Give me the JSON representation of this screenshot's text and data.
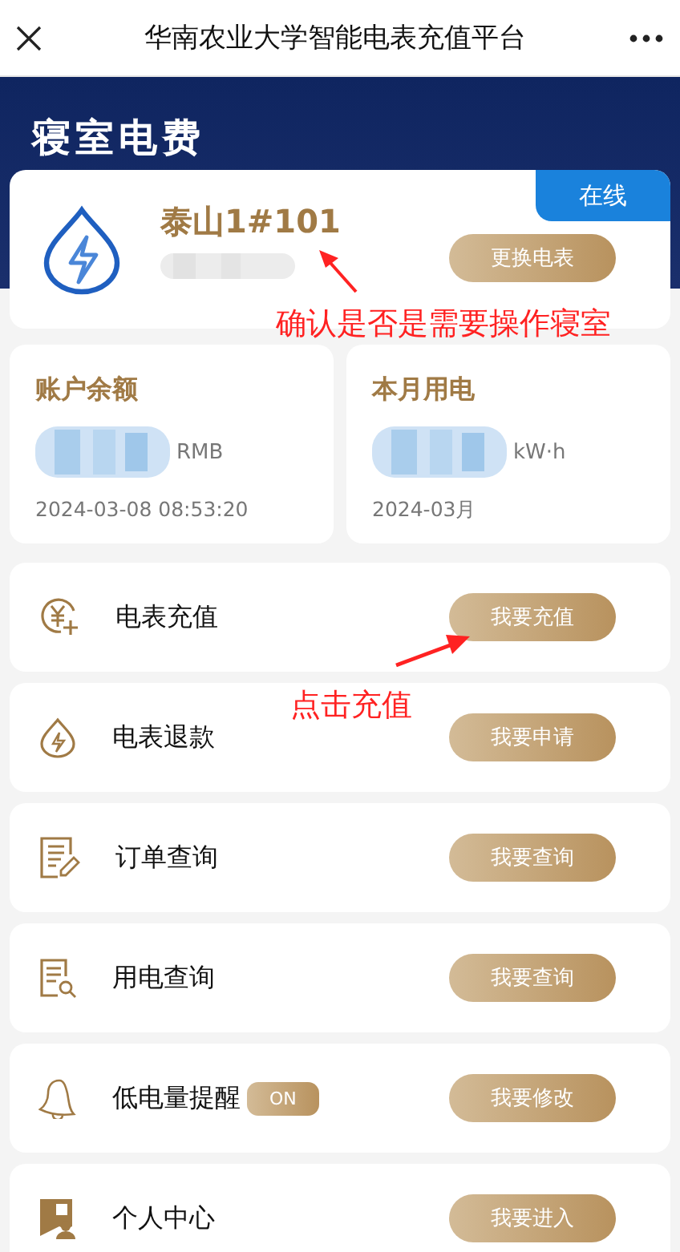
{
  "top_bar": {
    "title": "华南农业大学智能电表充值平台"
  },
  "header": {
    "title": "寝室电费"
  },
  "meter": {
    "name": "泰山1#101",
    "status": "在线",
    "online": true,
    "button": "更换电表"
  },
  "stats": [
    {
      "title": "账户余额",
      "unit": "RMB",
      "time": "2024-03-08 08:53:20"
    },
    {
      "title": "本月用电",
      "unit": "kW·h",
      "time": "2024-03月"
    }
  ],
  "menu": [
    {
      "label": "电表充值",
      "button": "我要充值"
    },
    {
      "label": "电表退款",
      "button": "我要申请"
    },
    {
      "label": "订单查询",
      "button": "我要查询"
    },
    {
      "label": "用电查询",
      "button": "我要查询"
    },
    {
      "label": "低电量提醒",
      "button": "我要修改",
      "badge": {
        "text": "ON",
        "on": true
      }
    },
    {
      "label": "个人中心",
      "button": "我要进入"
    }
  ],
  "annotations": [
    {
      "text": "确认是否是需要操作寝室"
    },
    {
      "text": "点击充值"
    }
  ]
}
